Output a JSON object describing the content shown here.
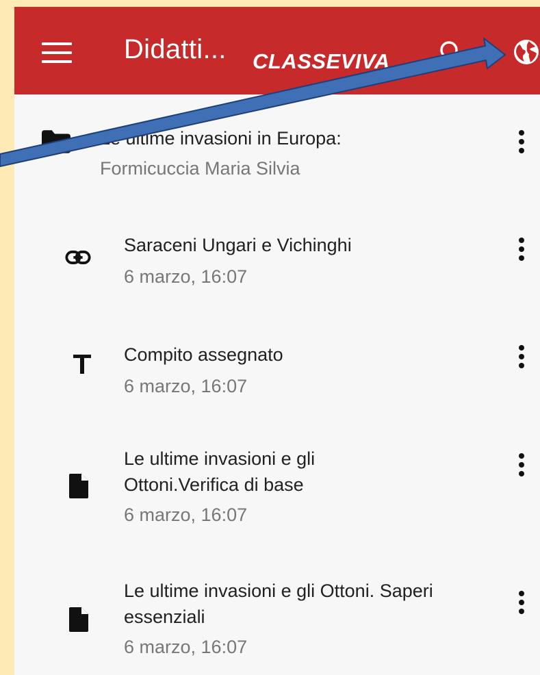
{
  "header": {
    "title": "Didatti...",
    "brand": "CLASSEVIVA"
  },
  "folder": {
    "title": "Le ultime invasioni in Europa:",
    "author": "Formicuccia Maria Silvia"
  },
  "items": [
    {
      "icon": "link-icon",
      "title": "Saraceni Ungari e Vichinghi",
      "date": "6 marzo, 16:07"
    },
    {
      "icon": "text-icon",
      "title": "Compito assegnato",
      "date": "6 marzo, 16:07"
    },
    {
      "icon": "file-icon",
      "title_line1": "Le ultime invasioni e gli",
      "title_line2": "Ottoni.Verifica di base",
      "date": "6 marzo, 16:07"
    },
    {
      "icon": "file-icon",
      "title_line1": "Le ultime invasioni e gli Ottoni. Saperi",
      "title_line2": "essenziali",
      "date": "6 marzo, 16:07"
    }
  ],
  "colors": {
    "appbar": "#c62a2a",
    "background": "#f7f7f7",
    "page_border": "#fdeab4",
    "arrow": "#3f6fb5"
  }
}
